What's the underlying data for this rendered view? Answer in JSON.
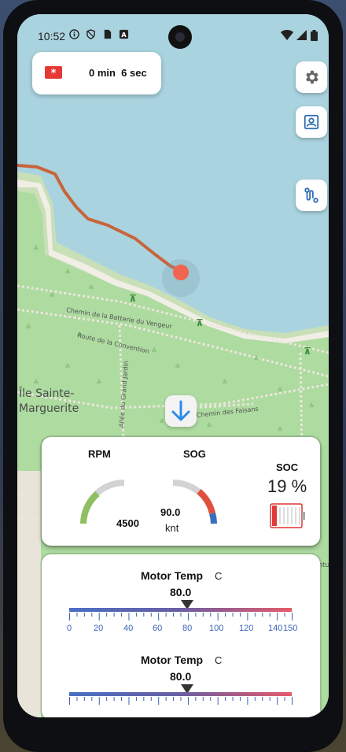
{
  "status_bar": {
    "time": "10:52",
    "left_icons": [
      "info-icon",
      "shield-icon",
      "sim-icon",
      "a-icon"
    ],
    "right_icons": [
      "wifi-icon",
      "signal-icon",
      "battery-icon"
    ]
  },
  "recording": {
    "icon": "camera-record-icon",
    "duration": "0 min  6 sec",
    "accent": "#e53935"
  },
  "map_buttons": [
    "gear-icon",
    "contact-icon",
    "route-icon"
  ],
  "map": {
    "labels": {
      "island_line1": "Île Sainte-",
      "island_line2": "Marguerite",
      "road1": "Chemin de la Batterie du Vengeur",
      "road2": "Route de la Convention",
      "road3": "Allée du Grand Jardin",
      "road4": "Chemin des Faisans",
      "edge_right": "Ceintu"
    },
    "track_color": "#c8643a",
    "position_color": "#f06450"
  },
  "scroll_down_icon": "arrow-down-icon",
  "gauges": {
    "rpm": {
      "label": "RPM",
      "value": "4500"
    },
    "sog": {
      "label": "SOG",
      "value": "90.0",
      "unit": "knt"
    },
    "soc": {
      "label": "SOC",
      "value": "19 %",
      "level": 0.19
    }
  },
  "temperature": [
    {
      "title": "Motor Temp",
      "unit": "C",
      "value": "80.0"
    },
    {
      "title": "Motor Temp",
      "unit": "C",
      "value": "80.0"
    }
  ],
  "temp_scale": {
    "ticks": [
      "0",
      "20",
      "40",
      "60",
      "80",
      "100",
      "120",
      "140",
      "150"
    ],
    "min": 0,
    "max": 150
  }
}
